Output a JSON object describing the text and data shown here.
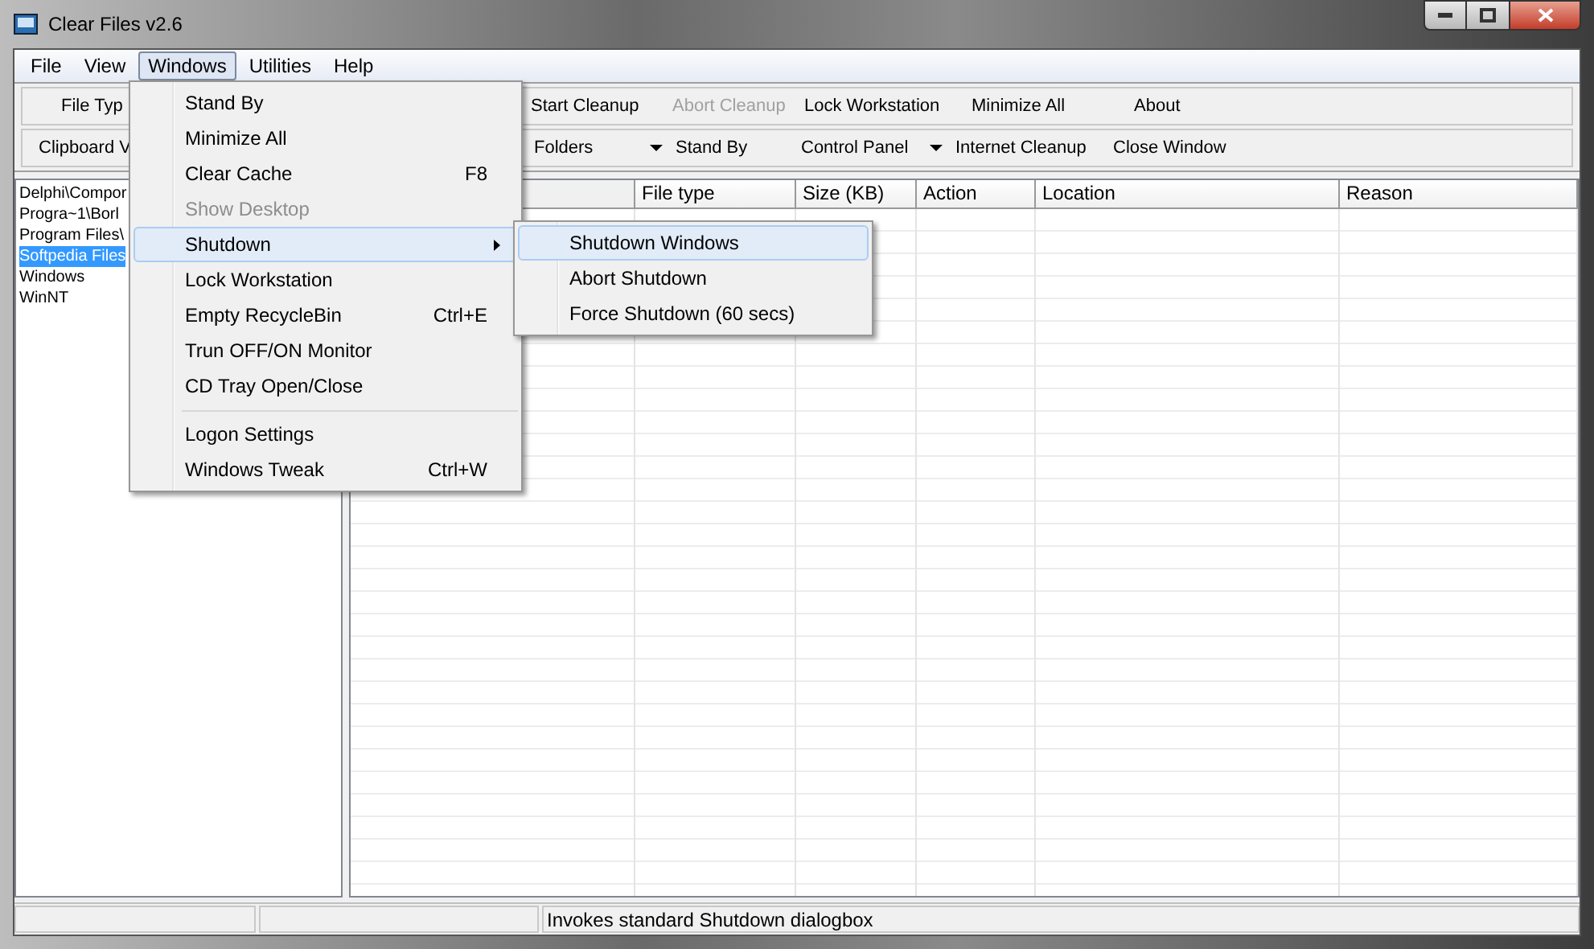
{
  "window": {
    "title": "Clear Files v2.6"
  },
  "menu_bar": [
    {
      "label": "File",
      "selected": false
    },
    {
      "label": "View",
      "selected": false
    },
    {
      "label": "Windows",
      "selected": true
    },
    {
      "label": "Utilities",
      "selected": false
    },
    {
      "label": "Help",
      "selected": false
    }
  ],
  "toolbar_1": [
    {
      "label": "File Typ",
      "disabled": false
    },
    {
      "label": "Start Cleanup",
      "disabled": false
    },
    {
      "label": "Abort Cleanup",
      "disabled": true
    },
    {
      "label": "Lock Workstation",
      "disabled": false
    },
    {
      "label": "Minimize All",
      "disabled": false
    },
    {
      "label": "About",
      "disabled": false
    }
  ],
  "toolbar_2": [
    {
      "label": "Clipboard V"
    },
    {
      "label": "Folders",
      "dropdown": true
    },
    {
      "label": "Stand By",
      "dropdown": false
    },
    {
      "label": "Control Panel",
      "dropdown": true
    },
    {
      "label": "Internet Cleanup",
      "dropdown": false
    },
    {
      "label": "Close Window",
      "dropdown": false
    }
  ],
  "folder_list": [
    {
      "label": "Delphi\\Compor",
      "selected": false
    },
    {
      "label": "Progra~1\\Borl",
      "selected": false
    },
    {
      "label": "Program Files\\",
      "selected": false
    },
    {
      "label": "Softpedia Files",
      "selected": true
    },
    {
      "label": "Windows",
      "selected": false
    },
    {
      "label": "WinNT",
      "selected": false
    }
  ],
  "table": {
    "columns": [
      "File type",
      "Size (KB)",
      "Action",
      "Location",
      "Reason"
    ]
  },
  "windows_menu": [
    {
      "kind": "item",
      "label": "Stand By",
      "disabled": false,
      "selected": false,
      "submenu": false
    },
    {
      "kind": "item",
      "label": "Minimize All",
      "disabled": false,
      "selected": false,
      "submenu": false
    },
    {
      "kind": "item",
      "label": "Clear Cache",
      "shortcut": "F8",
      "disabled": false,
      "selected": false,
      "submenu": false
    },
    {
      "kind": "item",
      "label": "Show Desktop",
      "disabled": true,
      "selected": false,
      "submenu": false
    },
    {
      "kind": "item",
      "label": "Shutdown",
      "disabled": false,
      "selected": true,
      "submenu": true
    },
    {
      "kind": "item",
      "label": "Lock Workstation",
      "disabled": false,
      "selected": false,
      "submenu": false
    },
    {
      "kind": "item",
      "label": "Empty RecycleBin",
      "shortcut": "Ctrl+E",
      "disabled": false,
      "selected": false,
      "submenu": false
    },
    {
      "kind": "item",
      "label": "Trun OFF/ON Monitor",
      "disabled": false,
      "selected": false,
      "submenu": false
    },
    {
      "kind": "item",
      "label": "CD Tray Open/Close",
      "disabled": false,
      "selected": false,
      "submenu": false
    },
    {
      "kind": "separator"
    },
    {
      "kind": "item",
      "label": "Logon Settings",
      "disabled": false,
      "selected": false,
      "submenu": false
    },
    {
      "kind": "item",
      "label": "Windows Tweak",
      "shortcut": "Ctrl+W",
      "disabled": false,
      "selected": false,
      "submenu": false
    }
  ],
  "shutdown_submenu": [
    {
      "label": "Shutdown Windows",
      "selected": true
    },
    {
      "label": "Abort Shutdown",
      "selected": false
    },
    {
      "label": "Force Shutdown (60 secs)",
      "selected": false
    }
  ],
  "status_bar": {
    "message": "Invokes standard Shutdown dialogbox"
  }
}
